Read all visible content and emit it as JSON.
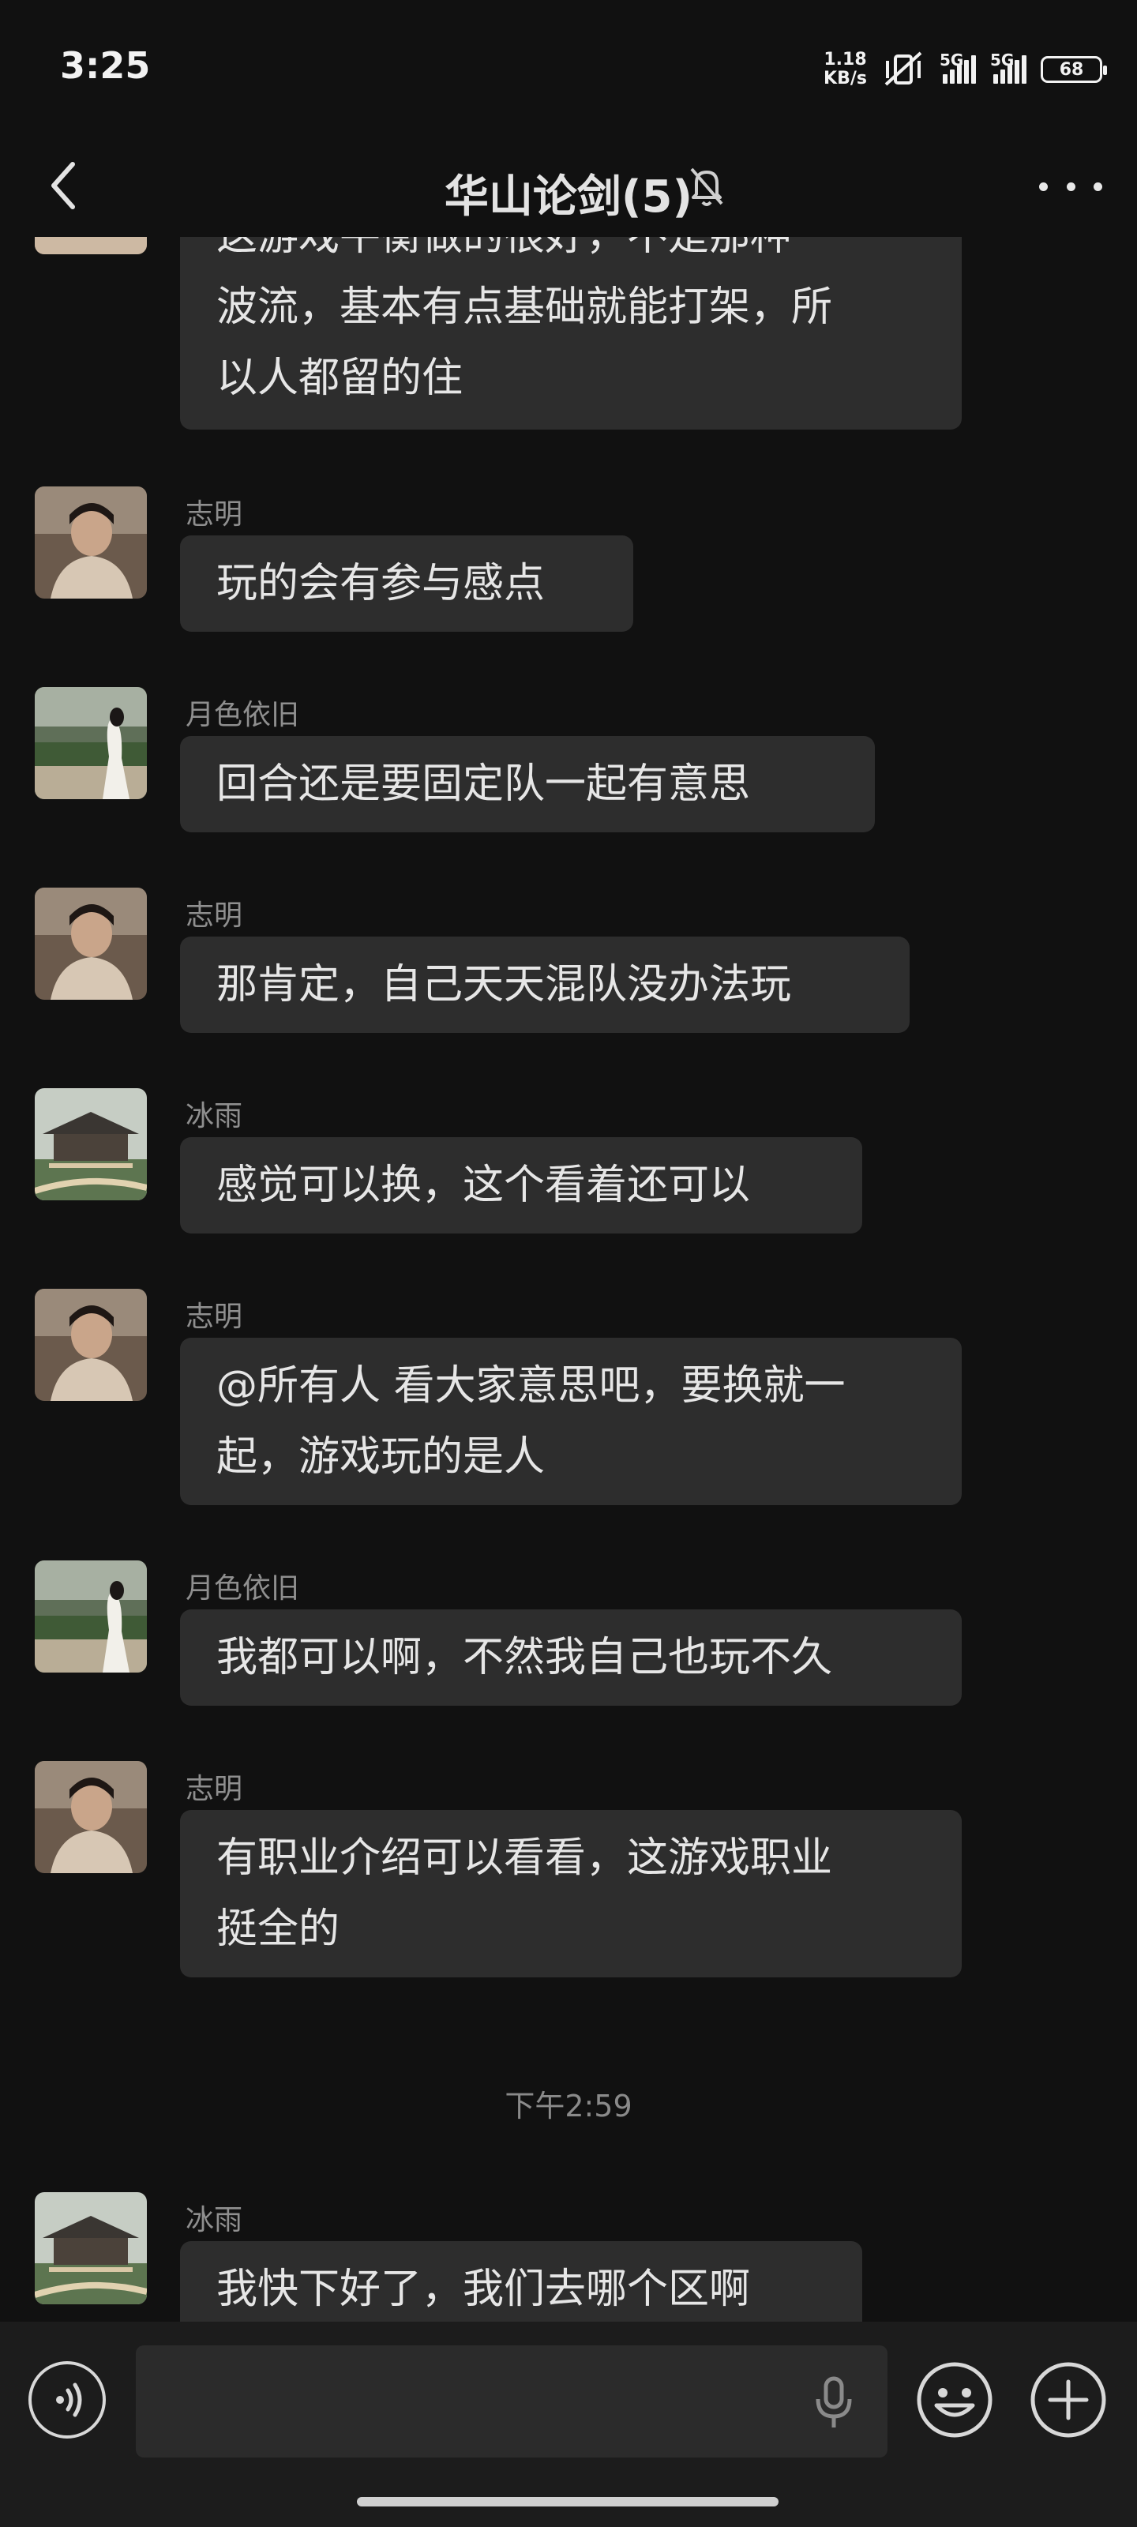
{
  "status_bar": {
    "time": "3:25",
    "net_speed_value": "1.18",
    "net_speed_unit": "KB/s",
    "signal1_label": "5G",
    "signal2_label": "5G",
    "battery": "68"
  },
  "header": {
    "title": "华山论剑(5)"
  },
  "messages": [
    {
      "sender": "",
      "lines": [
        "这游戏平衡做的很好，不是那种一",
        "波流，基本有点基础就能打架，所",
        "以人都留的住"
      ],
      "avatar": "portrait"
    },
    {
      "sender": "志明",
      "lines": [
        "玩的会有参与感点"
      ],
      "avatar": "portrait"
    },
    {
      "sender": "月色依旧",
      "lines": [
        "回合还是要固定队一起有意思"
      ],
      "avatar": "garden"
    },
    {
      "sender": "志明",
      "lines": [
        "那肯定，自己天天混队没办法玩"
      ],
      "avatar": "portrait"
    },
    {
      "sender": "冰雨",
      "lines": [
        "感觉可以换，这个看着还可以"
      ],
      "avatar": "pavilion"
    },
    {
      "sender": "志明",
      "lines": [
        "@所有人  看大家意思吧，要换就一",
        "起，游戏玩的是人"
      ],
      "avatar": "portrait"
    },
    {
      "sender": "月色依旧",
      "lines": [
        "我都可以啊，不然我自己也玩不久"
      ],
      "avatar": "garden"
    },
    {
      "sender": "志明",
      "lines": [
        "有职业介绍可以看看，这游戏职业",
        "挺全的"
      ],
      "avatar": "portrait"
    },
    {
      "sender": "冰雨",
      "lines": [
        "我快下好了，我们去哪个区啊"
      ],
      "avatar": "pavilion"
    }
  ],
  "time_divider": "下午2:59",
  "input": {
    "placeholder": ""
  },
  "icons": {
    "back": "chevron-left-icon",
    "mute": "bell-off-icon",
    "more": "more-dots-icon",
    "voice": "voice-icon",
    "mic": "microphone-icon",
    "emoji": "emoji-icon",
    "plus": "plus-icon"
  },
  "colors": {
    "background": "#111111",
    "bubble": "#2d2d2d",
    "input_bar": "#1c1c1c"
  }
}
